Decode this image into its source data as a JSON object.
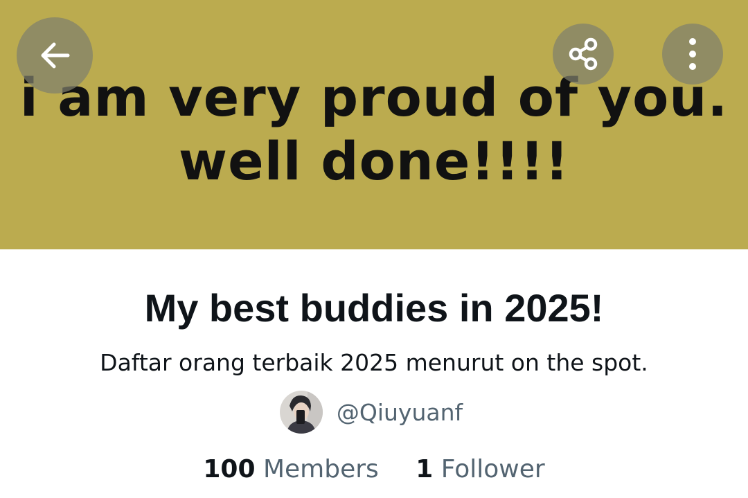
{
  "header": {
    "banner_color": "#bbab4f",
    "banner_lines": [
      "i am very proud of you.",
      "well done!!!!"
    ],
    "back_icon": "arrow-left-icon",
    "share_icon": "share-icon",
    "more_icon": "more-vertical-icon"
  },
  "list": {
    "title": "My best buddies in 2025!",
    "description": "Daftar orang terbaik 2025 menurut on the spot.",
    "owner_handle": "@Qiuyuanf",
    "members_count": "100",
    "members_label": "Members",
    "followers_count": "1",
    "followers_label": "Follower"
  },
  "colors": {
    "text_primary": "#0f1419",
    "text_secondary": "#536471",
    "overlay_button": "#80806c"
  }
}
